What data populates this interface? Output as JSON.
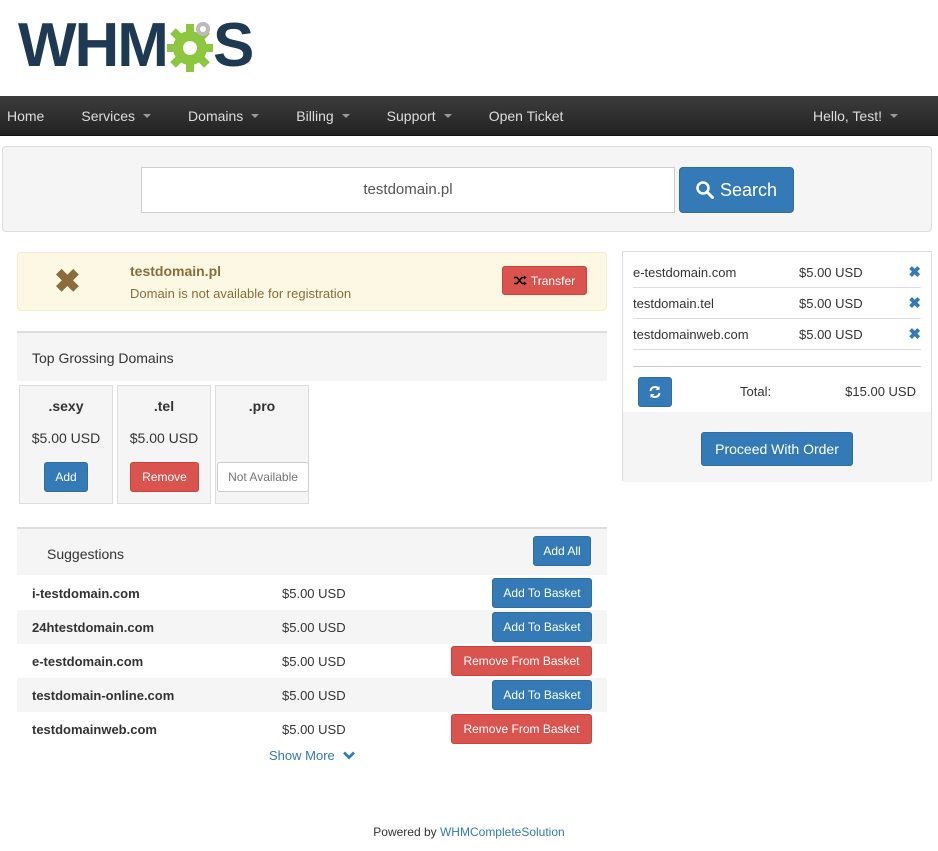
{
  "brand": {
    "logo_left": "WHM",
    "logo_right": "S"
  },
  "nav": {
    "items": [
      {
        "label": "Home",
        "dropdown": false
      },
      {
        "label": "Services",
        "dropdown": true
      },
      {
        "label": "Domains",
        "dropdown": true
      },
      {
        "label": "Billing",
        "dropdown": true
      },
      {
        "label": "Support",
        "dropdown": true
      },
      {
        "label": "Open Ticket",
        "dropdown": false
      }
    ],
    "user": "Hello, Test!"
  },
  "search": {
    "value": "testdomain.pl",
    "button_label": "Search"
  },
  "result": {
    "domain": "testdomain.pl",
    "message": "Domain is not available for registration",
    "transfer_label": "Transfer"
  },
  "top_grossing": {
    "title": "Top Grossing Domains",
    "tlds": [
      {
        "name": ".sexy",
        "price": "$5.00 USD",
        "button": "Add"
      },
      {
        "name": ".tel",
        "price": "$5.00 USD",
        "button": "Remove"
      },
      {
        "name": ".pro",
        "price": "",
        "button": "Not Available"
      }
    ]
  },
  "suggestions": {
    "title": "Suggestions",
    "add_all_label": "Add All",
    "rows": [
      {
        "domain": "i-testdomain.com",
        "price": "$5.00 USD",
        "action": "Add To Basket"
      },
      {
        "domain": "24htestdomain.com",
        "price": "$5.00 USD",
        "action": "Add To Basket"
      },
      {
        "domain": "e-testdomain.com",
        "price": "$5.00 USD",
        "action": "Remove From Basket"
      },
      {
        "domain": "testdomain-online.com",
        "price": "$5.00 USD",
        "action": "Add To Basket"
      },
      {
        "domain": "testdomainweb.com",
        "price": "$5.00 USD",
        "action": "Remove From Basket"
      }
    ],
    "show_more_label": "Show More"
  },
  "cart": {
    "items": [
      {
        "domain": "e-testdomain.com",
        "price": "$5.00 USD"
      },
      {
        "domain": "testdomain.tel",
        "price": "$5.00 USD"
      },
      {
        "domain": "testdomainweb.com",
        "price": "$5.00 USD"
      }
    ],
    "total_label": "Total:",
    "total_value": "$15.00 USD",
    "proceed_label": "Proceed With Order"
  },
  "footer": {
    "prefix": "Powered by ",
    "link": "WHMCompleteSolution"
  },
  "colors": {
    "primary": "#337ab7",
    "danger": "#d9534f",
    "warning_bg": "#fcf8e3",
    "logo_navy": "#1e3a52",
    "logo_green": "#8dc63f"
  }
}
